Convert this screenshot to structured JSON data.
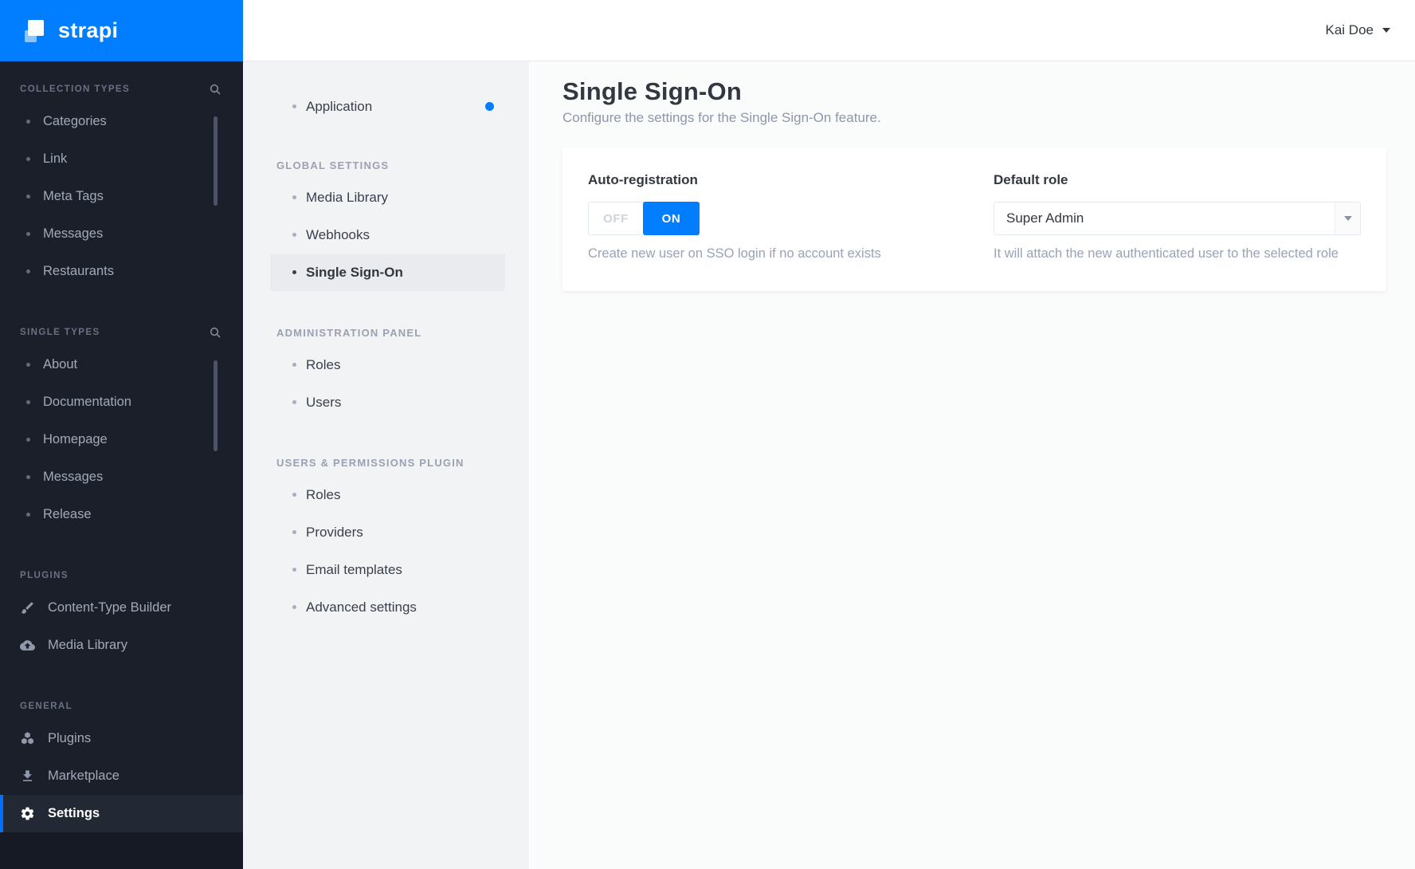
{
  "brand": {
    "name": "strapi"
  },
  "topbar": {
    "user_name": "Kai Doe"
  },
  "left_sidebar": {
    "sections": [
      {
        "title": "COLLECTION TYPES",
        "items": [
          "Categories",
          "Link",
          "Meta Tags",
          "Messages",
          "Restaurants"
        ]
      },
      {
        "title": "SINGLE TYPES",
        "items": [
          "About",
          "Documentation",
          "Homepage",
          "Messages",
          "Release"
        ]
      },
      {
        "title": "PLUGINS",
        "items": [
          "Content-Type Builder",
          "Media Library"
        ]
      },
      {
        "title": "GENERAL",
        "items": [
          "Plugins",
          "Marketplace",
          "Settings"
        ]
      }
    ]
  },
  "settings_nav": {
    "application_label": "Application",
    "sections": [
      {
        "title": "GLOBAL SETTINGS",
        "items": [
          "Media Library",
          "Webhooks",
          "Single Sign-On"
        ]
      },
      {
        "title": "ADMINISTRATION PANEL",
        "items": [
          "Roles",
          "Users"
        ]
      },
      {
        "title": "USERS & PERMISSIONS PLUGIN",
        "items": [
          "Roles",
          "Providers",
          "Email templates",
          "Advanced settings"
        ]
      }
    ]
  },
  "page": {
    "title": "Single Sign-On",
    "subtitle": "Configure the settings for the Single Sign-On feature."
  },
  "form": {
    "auto_registration": {
      "label": "Auto-registration",
      "off_label": "OFF",
      "on_label": "ON",
      "value": "ON",
      "hint": "Create new user on SSO login if no account exists"
    },
    "default_role": {
      "label": "Default role",
      "value": "Super Admin",
      "hint": "It will attach the new authenticated user to the selected role"
    }
  },
  "colors": {
    "accent": "#007eff",
    "sidebar_bg": "#1a1f2a",
    "active_indicator": "#0070ff"
  }
}
